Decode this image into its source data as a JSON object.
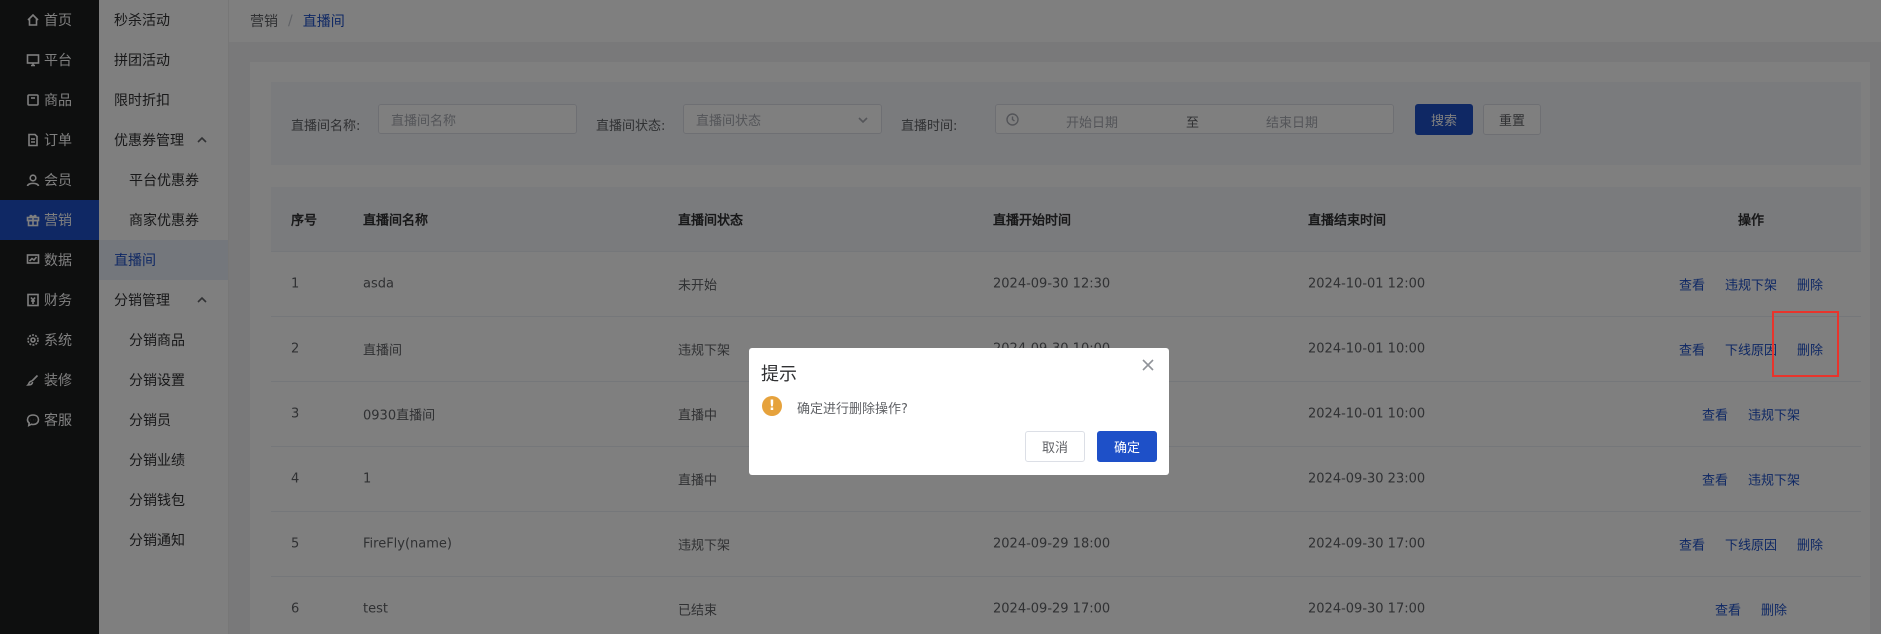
{
  "nav": {
    "items": [
      {
        "label": "首页",
        "icon": "home-icon"
      },
      {
        "label": "平台",
        "icon": "monitor-icon"
      },
      {
        "label": "商品",
        "icon": "goods-icon"
      },
      {
        "label": "订单",
        "icon": "order-icon"
      },
      {
        "label": "会员",
        "icon": "member-icon"
      },
      {
        "label": "营销",
        "icon": "gift-icon"
      },
      {
        "label": "数据",
        "icon": "chart-icon"
      },
      {
        "label": "财务",
        "icon": "finance-icon"
      },
      {
        "label": "系统",
        "icon": "gear-icon"
      },
      {
        "label": "装修",
        "icon": "brush-icon"
      },
      {
        "label": "客服",
        "icon": "chat-icon"
      }
    ],
    "active_index": 5
  },
  "subnav": {
    "items": [
      {
        "label": "秒杀活动"
      },
      {
        "label": "拼团活动"
      },
      {
        "label": "限时折扣"
      },
      {
        "label": "优惠券管理"
      },
      {
        "label": "平台优惠券"
      },
      {
        "label": "商家优惠券"
      },
      {
        "label": "直播间"
      },
      {
        "label": "分销管理"
      },
      {
        "label": "分销商品"
      },
      {
        "label": "分销设置"
      },
      {
        "label": "分销员"
      },
      {
        "label": "分销业绩"
      },
      {
        "label": "分销钱包"
      },
      {
        "label": "分销通知"
      }
    ]
  },
  "breadcrumb": {
    "parent": "营销",
    "separator": "/",
    "current": "直播间"
  },
  "filter": {
    "name_label": "直播间名称:",
    "name_placeholder": "直播间名称",
    "status_label": "直播间状态:",
    "status_placeholder": "直播间状态",
    "time_label": "直播时间:",
    "start_placeholder": "开始日期",
    "range_sep": "至",
    "end_placeholder": "结束日期",
    "search_btn": "搜索",
    "reset_btn": "重置"
  },
  "table": {
    "headers": [
      "序号",
      "直播间名称",
      "直播间状态",
      "直播开始时间",
      "直播结束时间",
      "操作"
    ],
    "rows": [
      {
        "no": "1",
        "name": "asda",
        "status": "未开始",
        "start": "2024-09-30 12:30",
        "end": "2024-10-01 12:00",
        "ops": [
          "查看",
          "违规下架",
          "删除"
        ]
      },
      {
        "no": "2",
        "name": "直播间",
        "status": "违规下架",
        "start": "2024-09-30 10:00",
        "end": "2024-10-01 10:00",
        "ops": [
          "查看",
          "下线原因",
          "删除"
        ]
      },
      {
        "no": "3",
        "name": "0930直播间",
        "status": "直播中",
        "start": "",
        "end": "2024-10-01 10:00",
        "ops": [
          "查看",
          "违规下架"
        ]
      },
      {
        "no": "4",
        "name": "1",
        "status": "直播中",
        "start": "",
        "end": "2024-09-30 23:00",
        "ops": [
          "查看",
          "违规下架"
        ]
      },
      {
        "no": "5",
        "name": "FireFly(name)",
        "status": "违规下架",
        "start": "2024-09-29 18:00",
        "end": "2024-09-30 17:00",
        "ops": [
          "查看",
          "下线原因",
          "删除"
        ]
      },
      {
        "no": "6",
        "name": "test",
        "status": "已结束",
        "start": "2024-09-29 17:00",
        "end": "2024-09-30 17:00",
        "ops": [
          "查看",
          "删除"
        ]
      }
    ]
  },
  "dialog": {
    "title": "提示",
    "message": "确定进行删除操作?",
    "cancel": "取消",
    "confirm": "确定",
    "warn_icon": "!"
  },
  "colors": {
    "primary": "#1e50c8",
    "nav_bg": "#1d1e1f",
    "warning": "#e6a23c",
    "highlight": "#e8342c"
  }
}
